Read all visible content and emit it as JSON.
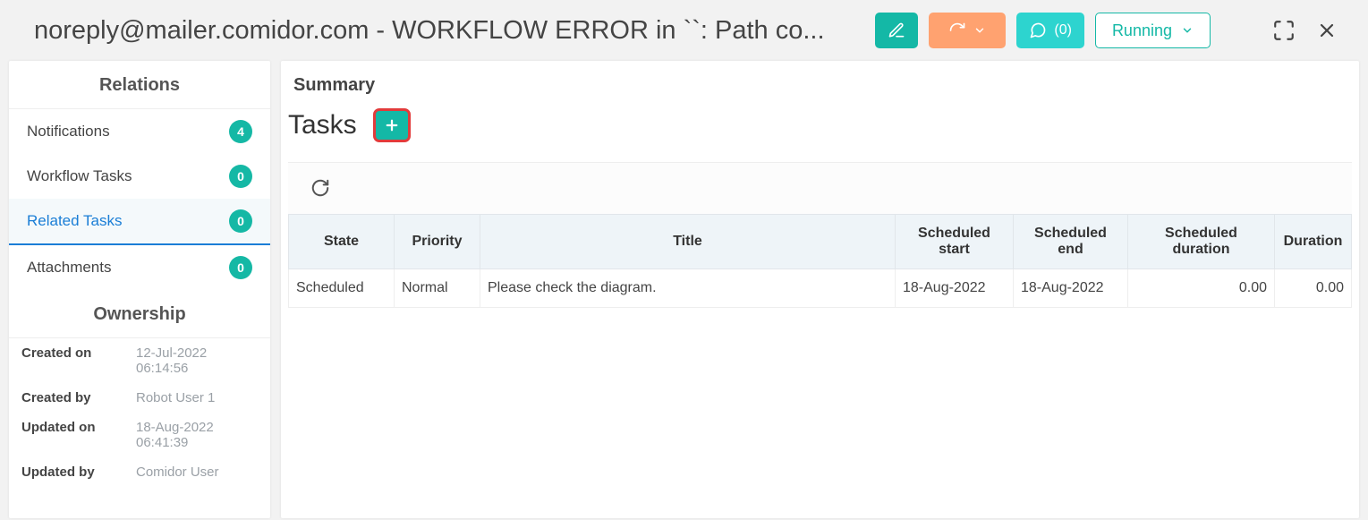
{
  "header": {
    "title": "noreply@mailer.comidor.com - WORKFLOW ERROR in ``: Path co...",
    "comments_label": "(0)",
    "status_label": "Running"
  },
  "sidebar": {
    "relations_title": "Relations",
    "items": [
      {
        "label": "Notifications",
        "count": "4",
        "active": false
      },
      {
        "label": "Workflow Tasks",
        "count": "0",
        "active": false
      },
      {
        "label": "Related Tasks",
        "count": "0",
        "active": true
      },
      {
        "label": "Attachments",
        "count": "0",
        "active": false
      }
    ],
    "ownership_title": "Ownership",
    "ownership": [
      {
        "label": "Created on",
        "value": "12-Jul-2022 06:14:56"
      },
      {
        "label": "Created by",
        "value": "Robot User 1"
      },
      {
        "label": "Updated on",
        "value": "18-Aug-2022 06:41:39"
      },
      {
        "label": "Updated by",
        "value": "Comidor User"
      }
    ]
  },
  "content": {
    "summary_label": "Summary",
    "tasks_title": "Tasks",
    "table": {
      "columns": [
        "State",
        "Priority",
        "Title",
        "Scheduled start",
        "Scheduled end",
        "Scheduled duration",
        "Duration"
      ],
      "rows": [
        {
          "state": "Scheduled",
          "priority": "Normal",
          "title": "Please check the diagram.",
          "scheduled_start": "18-Aug-2022",
          "scheduled_end": "18-Aug-2022",
          "scheduled_duration": "0.00",
          "duration": "0.00"
        }
      ]
    }
  }
}
